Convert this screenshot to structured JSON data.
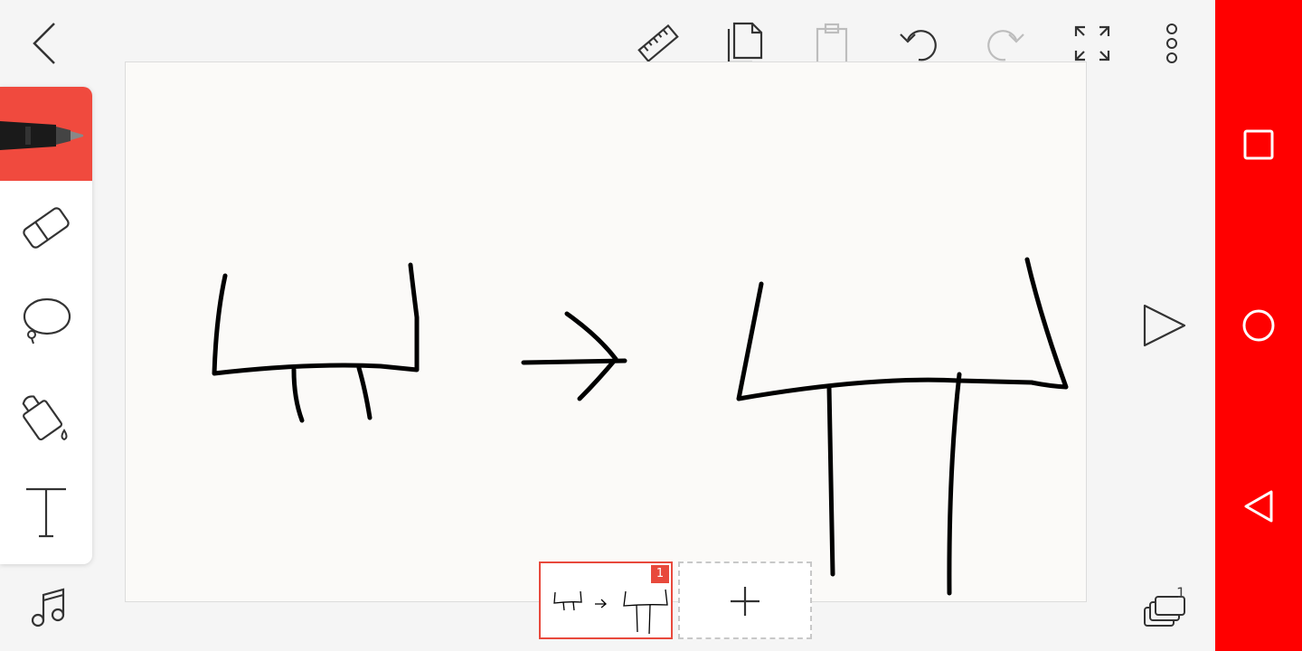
{
  "toolbar": {
    "icons": [
      "back-icon",
      "ruler-icon",
      "copy-icon",
      "paste-icon",
      "undo-icon",
      "redo-icon",
      "fullscreen-icon",
      "more-icon"
    ]
  },
  "tools": {
    "items": [
      "pen",
      "eraser",
      "lasso",
      "fill",
      "text"
    ],
    "active": "pen",
    "accent": "#f04a3e"
  },
  "frames": {
    "current_frame_number": "1",
    "add_symbol": "+"
  },
  "layers": {
    "count": "1"
  },
  "colors": {
    "nav_bar": "#ff0000",
    "accent": "#e8493c",
    "canvas": "#fbfaf8"
  }
}
